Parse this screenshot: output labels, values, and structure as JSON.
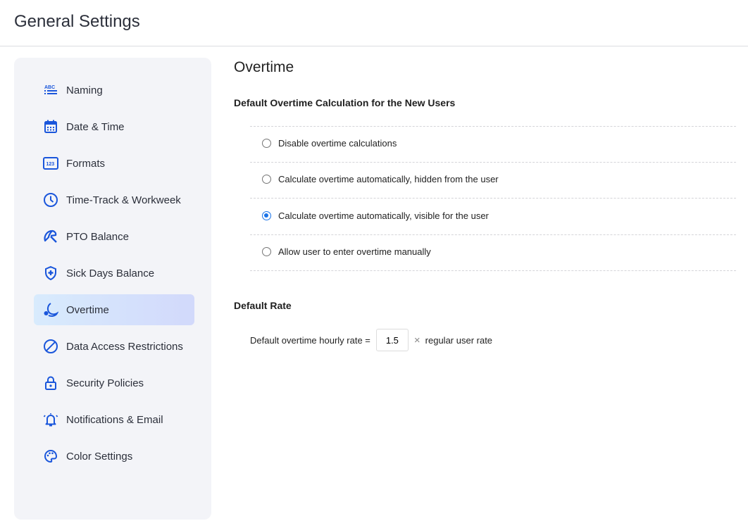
{
  "header": {
    "title": "General Settings"
  },
  "sidebar": {
    "items": [
      {
        "label": "Naming",
        "icon": "abc-list-icon"
      },
      {
        "label": "Date & Time",
        "icon": "calendar-icon"
      },
      {
        "label": "Formats",
        "icon": "numbers-123-icon"
      },
      {
        "label": "Time-Track & Workweek",
        "icon": "clock-icon"
      },
      {
        "label": "PTO Balance",
        "icon": "beach-umbrella-icon"
      },
      {
        "label": "Sick Days Balance",
        "icon": "shield-plus-icon"
      },
      {
        "label": "Overtime",
        "icon": "moon-icon",
        "active": true
      },
      {
        "label": "Data Access Restrictions",
        "icon": "block-icon"
      },
      {
        "label": "Security Policies",
        "icon": "lock-icon"
      },
      {
        "label": "Notifications & Email",
        "icon": "bell-icon"
      },
      {
        "label": "Color Settings",
        "icon": "palette-icon"
      }
    ]
  },
  "main": {
    "title": "Overtime",
    "calc_heading": "Default Overtime Calculation for the New Users",
    "options": [
      {
        "label": "Disable overtime calculations",
        "selected": false
      },
      {
        "label": "Calculate overtime automatically, hidden from the user",
        "selected": false
      },
      {
        "label": "Calculate overtime automatically, visible for the user",
        "selected": true
      },
      {
        "label": "Allow user to enter overtime manually",
        "selected": false
      }
    ],
    "rate_heading": "Default Rate",
    "rate_prefix": "Default overtime hourly rate =",
    "rate_value": "1.5",
    "rate_times": "×",
    "rate_suffix": "regular user rate"
  },
  "colors": {
    "accent": "#1a56db",
    "radio": "#1a73e8",
    "sidebar_bg": "#f3f4f8"
  }
}
